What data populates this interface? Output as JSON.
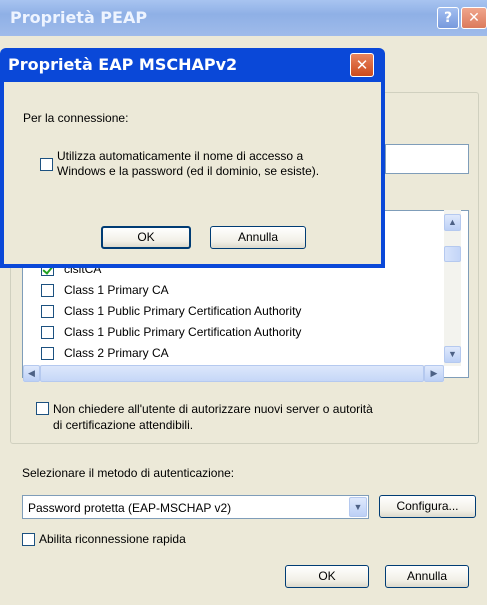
{
  "peap": {
    "title": "Proprietà PEAP",
    "help_label": "?",
    "close_label": "✕",
    "certificates": [
      {
        "label": "cisitCA",
        "checked": true
      },
      {
        "label": "Class 1 Primary CA",
        "checked": false
      },
      {
        "label": "Class 1 Public Primary Certification Authority",
        "checked": false
      },
      {
        "label": "Class 1 Public Primary Certification Authority",
        "checked": false
      },
      {
        "label": "Class 2 Primary CA",
        "checked": false
      }
    ],
    "dont_prompt_line1": "Non chiedere all'utente di autorizzare nuovi server o autorità",
    "dont_prompt_line2": "di certificazione attendibili.",
    "auth_method_label": "Selezionare il metodo di autenticazione:",
    "auth_method_value": "Password protetta (EAP-MSCHAP v2)",
    "configure_label": "Configura...",
    "fast_reconnect_label": "Abilita riconnessione rapida",
    "ok_label": "OK",
    "cancel_label": "Annulla"
  },
  "dialog": {
    "title": "Proprietà EAP MSCHAPv2",
    "close_label": "✕",
    "connection_label": "Per la connessione:",
    "autologon_line1": "Utilizza automaticamente il nome di accesso a",
    "autologon_line2": "Windows e la password (ed il dominio, se esiste).",
    "autologon_checked": false,
    "ok_label": "OK",
    "cancel_label": "Annulla"
  },
  "icons": {
    "scroll_up": "▲",
    "scroll_down": "▼",
    "scroll_left": "◀",
    "scroll_right": "▶",
    "combo_down": "▼"
  }
}
